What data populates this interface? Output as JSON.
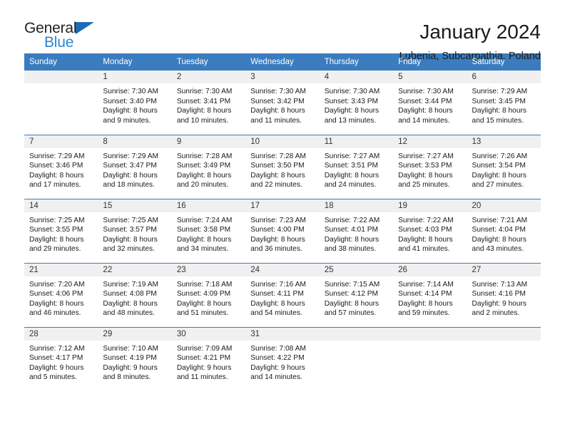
{
  "brand": {
    "name_part1": "General",
    "name_part2": "Blue",
    "triangle_color": "#1b6cb5",
    "blue_color": "#2787d4"
  },
  "header": {
    "title": "January 2024",
    "subtitle": "Lubenia, Subcarpathia, Poland"
  },
  "calendar": {
    "header_bg": "#3a7cbe",
    "daynum_bg": "#f0f0f0",
    "weekday_headers": [
      "Sunday",
      "Monday",
      "Tuesday",
      "Wednesday",
      "Thursday",
      "Friday",
      "Saturday"
    ],
    "weeks": [
      [
        {
          "day": "",
          "empty": true
        },
        {
          "day": "1",
          "sunrise": "Sunrise: 7:30 AM",
          "sunset": "Sunset: 3:40 PM",
          "daylight1": "Daylight: 8 hours",
          "daylight2": "and 9 minutes."
        },
        {
          "day": "2",
          "sunrise": "Sunrise: 7:30 AM",
          "sunset": "Sunset: 3:41 PM",
          "daylight1": "Daylight: 8 hours",
          "daylight2": "and 10 minutes."
        },
        {
          "day": "3",
          "sunrise": "Sunrise: 7:30 AM",
          "sunset": "Sunset: 3:42 PM",
          "daylight1": "Daylight: 8 hours",
          "daylight2": "and 11 minutes."
        },
        {
          "day": "4",
          "sunrise": "Sunrise: 7:30 AM",
          "sunset": "Sunset: 3:43 PM",
          "daylight1": "Daylight: 8 hours",
          "daylight2": "and 13 minutes."
        },
        {
          "day": "5",
          "sunrise": "Sunrise: 7:30 AM",
          "sunset": "Sunset: 3:44 PM",
          "daylight1": "Daylight: 8 hours",
          "daylight2": "and 14 minutes."
        },
        {
          "day": "6",
          "sunrise": "Sunrise: 7:29 AM",
          "sunset": "Sunset: 3:45 PM",
          "daylight1": "Daylight: 8 hours",
          "daylight2": "and 15 minutes."
        }
      ],
      [
        {
          "day": "7",
          "sunrise": "Sunrise: 7:29 AM",
          "sunset": "Sunset: 3:46 PM",
          "daylight1": "Daylight: 8 hours",
          "daylight2": "and 17 minutes."
        },
        {
          "day": "8",
          "sunrise": "Sunrise: 7:29 AM",
          "sunset": "Sunset: 3:47 PM",
          "daylight1": "Daylight: 8 hours",
          "daylight2": "and 18 minutes."
        },
        {
          "day": "9",
          "sunrise": "Sunrise: 7:28 AM",
          "sunset": "Sunset: 3:49 PM",
          "daylight1": "Daylight: 8 hours",
          "daylight2": "and 20 minutes."
        },
        {
          "day": "10",
          "sunrise": "Sunrise: 7:28 AM",
          "sunset": "Sunset: 3:50 PM",
          "daylight1": "Daylight: 8 hours",
          "daylight2": "and 22 minutes."
        },
        {
          "day": "11",
          "sunrise": "Sunrise: 7:27 AM",
          "sunset": "Sunset: 3:51 PM",
          "daylight1": "Daylight: 8 hours",
          "daylight2": "and 24 minutes."
        },
        {
          "day": "12",
          "sunrise": "Sunrise: 7:27 AM",
          "sunset": "Sunset: 3:53 PM",
          "daylight1": "Daylight: 8 hours",
          "daylight2": "and 25 minutes."
        },
        {
          "day": "13",
          "sunrise": "Sunrise: 7:26 AM",
          "sunset": "Sunset: 3:54 PM",
          "daylight1": "Daylight: 8 hours",
          "daylight2": "and 27 minutes."
        }
      ],
      [
        {
          "day": "14",
          "sunrise": "Sunrise: 7:25 AM",
          "sunset": "Sunset: 3:55 PM",
          "daylight1": "Daylight: 8 hours",
          "daylight2": "and 29 minutes."
        },
        {
          "day": "15",
          "sunrise": "Sunrise: 7:25 AM",
          "sunset": "Sunset: 3:57 PM",
          "daylight1": "Daylight: 8 hours",
          "daylight2": "and 32 minutes."
        },
        {
          "day": "16",
          "sunrise": "Sunrise: 7:24 AM",
          "sunset": "Sunset: 3:58 PM",
          "daylight1": "Daylight: 8 hours",
          "daylight2": "and 34 minutes."
        },
        {
          "day": "17",
          "sunrise": "Sunrise: 7:23 AM",
          "sunset": "Sunset: 4:00 PM",
          "daylight1": "Daylight: 8 hours",
          "daylight2": "and 36 minutes."
        },
        {
          "day": "18",
          "sunrise": "Sunrise: 7:22 AM",
          "sunset": "Sunset: 4:01 PM",
          "daylight1": "Daylight: 8 hours",
          "daylight2": "and 38 minutes."
        },
        {
          "day": "19",
          "sunrise": "Sunrise: 7:22 AM",
          "sunset": "Sunset: 4:03 PM",
          "daylight1": "Daylight: 8 hours",
          "daylight2": "and 41 minutes."
        },
        {
          "day": "20",
          "sunrise": "Sunrise: 7:21 AM",
          "sunset": "Sunset: 4:04 PM",
          "daylight1": "Daylight: 8 hours",
          "daylight2": "and 43 minutes."
        }
      ],
      [
        {
          "day": "21",
          "sunrise": "Sunrise: 7:20 AM",
          "sunset": "Sunset: 4:06 PM",
          "daylight1": "Daylight: 8 hours",
          "daylight2": "and 46 minutes."
        },
        {
          "day": "22",
          "sunrise": "Sunrise: 7:19 AM",
          "sunset": "Sunset: 4:08 PM",
          "daylight1": "Daylight: 8 hours",
          "daylight2": "and 48 minutes."
        },
        {
          "day": "23",
          "sunrise": "Sunrise: 7:18 AM",
          "sunset": "Sunset: 4:09 PM",
          "daylight1": "Daylight: 8 hours",
          "daylight2": "and 51 minutes."
        },
        {
          "day": "24",
          "sunrise": "Sunrise: 7:16 AM",
          "sunset": "Sunset: 4:11 PM",
          "daylight1": "Daylight: 8 hours",
          "daylight2": "and 54 minutes."
        },
        {
          "day": "25",
          "sunrise": "Sunrise: 7:15 AM",
          "sunset": "Sunset: 4:12 PM",
          "daylight1": "Daylight: 8 hours",
          "daylight2": "and 57 minutes."
        },
        {
          "day": "26",
          "sunrise": "Sunrise: 7:14 AM",
          "sunset": "Sunset: 4:14 PM",
          "daylight1": "Daylight: 8 hours",
          "daylight2": "and 59 minutes."
        },
        {
          "day": "27",
          "sunrise": "Sunrise: 7:13 AM",
          "sunset": "Sunset: 4:16 PM",
          "daylight1": "Daylight: 9 hours",
          "daylight2": "and 2 minutes."
        }
      ],
      [
        {
          "day": "28",
          "sunrise": "Sunrise: 7:12 AM",
          "sunset": "Sunset: 4:17 PM",
          "daylight1": "Daylight: 9 hours",
          "daylight2": "and 5 minutes."
        },
        {
          "day": "29",
          "sunrise": "Sunrise: 7:10 AM",
          "sunset": "Sunset: 4:19 PM",
          "daylight1": "Daylight: 9 hours",
          "daylight2": "and 8 minutes."
        },
        {
          "day": "30",
          "sunrise": "Sunrise: 7:09 AM",
          "sunset": "Sunset: 4:21 PM",
          "daylight1": "Daylight: 9 hours",
          "daylight2": "and 11 minutes."
        },
        {
          "day": "31",
          "sunrise": "Sunrise: 7:08 AM",
          "sunset": "Sunset: 4:22 PM",
          "daylight1": "Daylight: 9 hours",
          "daylight2": "and 14 minutes."
        },
        {
          "day": "",
          "empty": true
        },
        {
          "day": "",
          "empty": true
        },
        {
          "day": "",
          "empty": true
        }
      ]
    ]
  }
}
